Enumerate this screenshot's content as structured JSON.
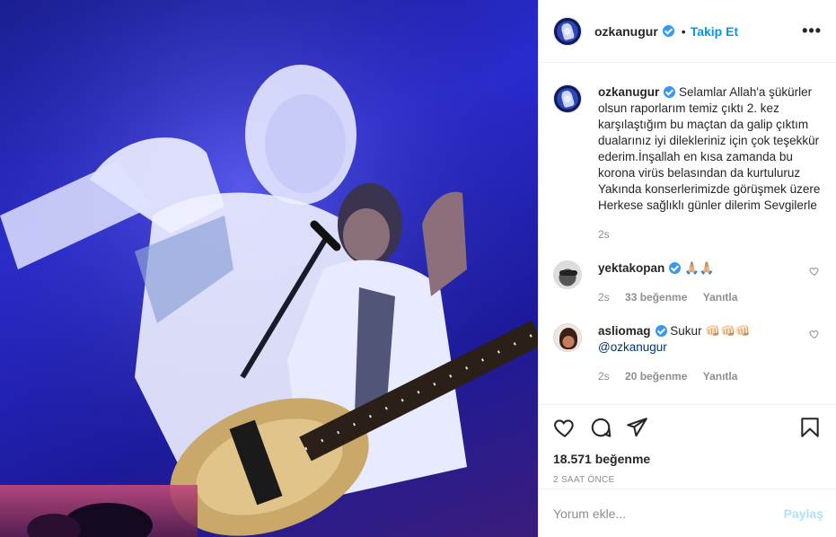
{
  "post": {
    "image_alt": "concert photo",
    "author": {
      "username": "ozkanugur",
      "verified": true,
      "follow_label": "Takip Et",
      "dot": "•",
      "more_label": "•••"
    },
    "caption": {
      "username": "ozkanugur",
      "text": "Selamlar Allah'a şükürler olsun raporlarım temiz çıktı 2. kez karşılaştığım bu maçtan da galip çıktım dualarınız iyi dilekleriniz için çok teşekkür ederim.İnşallah en kısa zamanda bu korona virüs belasından da kurtuluruz Yakında konserlerimizde görüşmek üzere Herkese sağlıklı günler dilerim Sevgilerle",
      "age": "2s"
    },
    "comments": [
      {
        "username": "yektakopan",
        "verified": true,
        "text": "🙏🏼🙏🏼",
        "age": "2s",
        "likes": "33 beğenme",
        "reply_label": "Yanıtla"
      },
      {
        "username": "asliomag",
        "verified": true,
        "text": "Sukur 👊🏻👊🏻👊🏻",
        "mention": "@ozkanugur",
        "age": "2s",
        "likes": "20 beğenme",
        "reply_label": "Yanıtla"
      }
    ],
    "likes_count": "18.571 beğenme",
    "timestamp": "2 SAAT ÖNCE",
    "comment_input": {
      "placeholder": "Yorum ekle...",
      "submit_label": "Paylaş"
    }
  },
  "icons": {
    "like": "heart-icon",
    "comment": "comment-icon",
    "share": "paper-plane-icon",
    "save": "bookmark-icon",
    "comment_like": "heart-icon"
  },
  "colors": {
    "accent": "#0095f6",
    "verified": "#3897f0",
    "share_disabled": "#b2dffc",
    "muted": "#8e8e8e"
  }
}
